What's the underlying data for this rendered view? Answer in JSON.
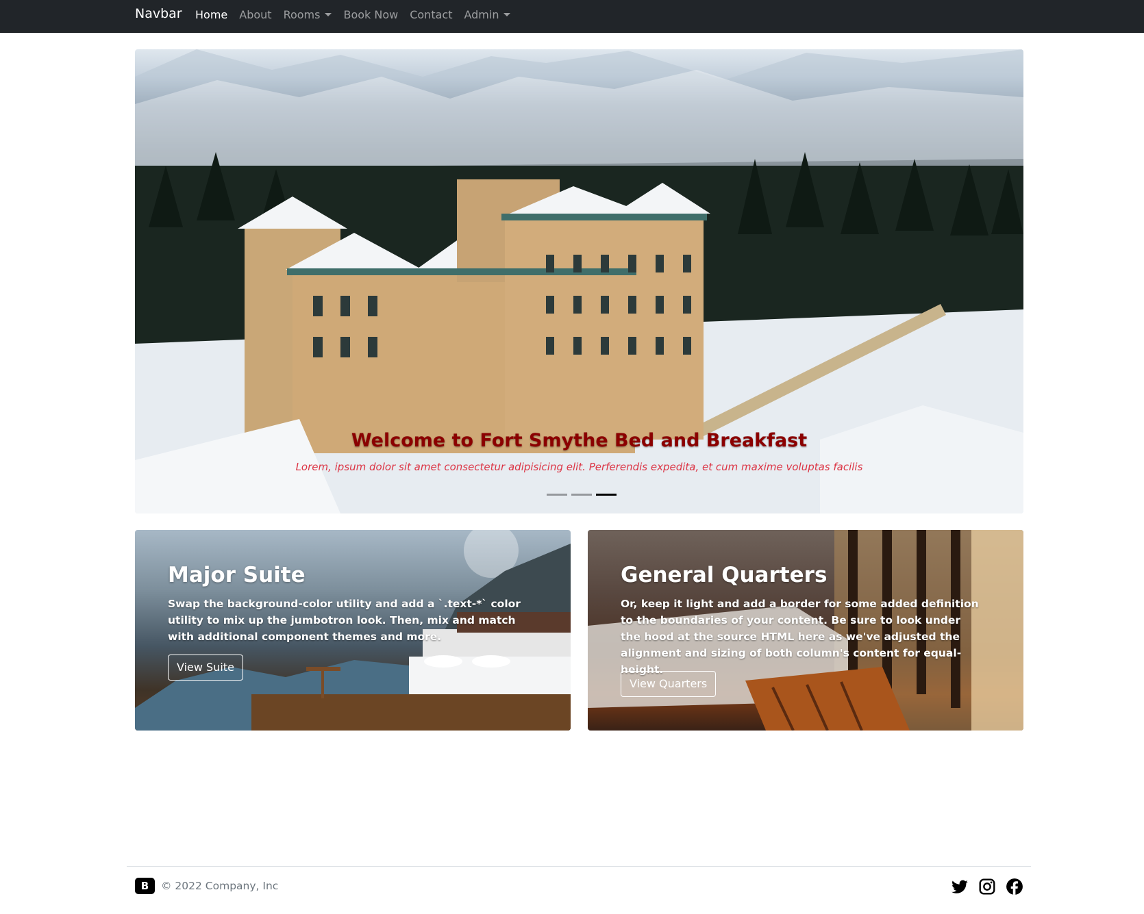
{
  "navbar": {
    "brand": "Navbar",
    "items": [
      {
        "label": "Home",
        "active": true,
        "dropdown": false
      },
      {
        "label": "About",
        "active": false,
        "dropdown": false
      },
      {
        "label": "Rooms",
        "active": false,
        "dropdown": true
      },
      {
        "label": "Book Now",
        "active": false,
        "dropdown": false
      },
      {
        "label": "Contact",
        "active": false,
        "dropdown": false
      },
      {
        "label": "Admin",
        "active": false,
        "dropdown": true
      }
    ]
  },
  "hero": {
    "title": "Welcome to Fort Smythe Bed and Breakfast",
    "subtitle": "Lorem, ipsum dolor sit amet consectetur adipisicing elit. Perferendis expedita, et cum maxime voluptas facilis",
    "slide_count": 3,
    "active_slide": 3
  },
  "cards": [
    {
      "title": "Major Suite",
      "text": "Swap the background-color utility and add a `.text-*` color utility to mix up the jumbotron look. Then, mix and match with additional component themes and more.",
      "button": "View Suite"
    },
    {
      "title": "General Quarters",
      "text": "Or, keep it light and add a border for some added definition to the boundaries of your content. Be sure to look under the hood at the source HTML here as we've adjusted the alignment and sizing of both column's content for equal-height.",
      "button": "View Quarters"
    }
  ],
  "footer": {
    "logo": "B",
    "copyright": "© 2022 Company, Inc",
    "social": [
      "twitter-icon",
      "instagram-icon",
      "facebook-icon"
    ]
  },
  "colors": {
    "navbar_bg": "#212529",
    "hero_title": "#8b0000",
    "hero_subtitle": "#dc3545",
    "footer_text": "#6c757d"
  }
}
